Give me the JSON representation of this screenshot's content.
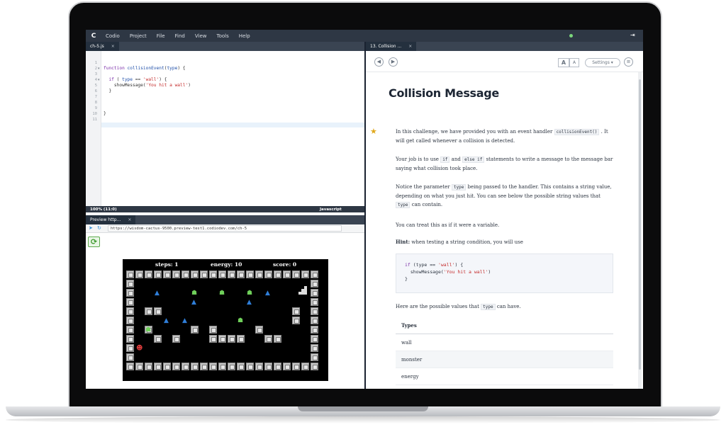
{
  "menu": {
    "items": [
      "Codio",
      "Project",
      "File",
      "Find",
      "View",
      "Tools",
      "Help"
    ]
  },
  "editor": {
    "tab_label": "ch-5.js",
    "tab_close": "×",
    "line_numbers": [
      "1",
      "2",
      "3",
      "4",
      "5",
      "6",
      "7",
      "8",
      "9",
      "10",
      "11"
    ],
    "status_position": "100%   (11:0)",
    "status_language": "Javascript"
  },
  "preview": {
    "tab_label": "Preview http...",
    "tab_close": "×",
    "url": "https://wisdom-cactus-9500.preview-test1.codiodev.com/ch-5",
    "reload_symbol": "⟳"
  },
  "game": {
    "steps": "steps: 1",
    "energy": "energy: 10",
    "score": "score: 0"
  },
  "guide": {
    "tab_label": "13. Collision ...",
    "tab_close": "×",
    "title": "Collision Message",
    "settings_label": "Settings",
    "p1_a": "In this challenge, we have provided you with an event handler",
    "p1_code": "collisionEvent()",
    "p1_b": ". It will get called whenever a collision is detected.",
    "p2_a": "Your job is to use",
    "p2_code1": "if",
    "p2_and": "and",
    "p2_code2": "else if",
    "p2_b": "statements to write a message to the message bar saying what collision took place.",
    "p3_a": "Notice the parameter",
    "p3_code": "type",
    "p3_b": "being passed to the handler. This contains a string value, depending on what you just hit. You can see below the possible string values that",
    "p3_code2": "type",
    "p3_c": "can contain.",
    "p4": "You can treat this as if it were a variable.",
    "hint_label": "Hint:",
    "hint_text": "when testing a string condition, you will use",
    "p5_a": "Here are the possible values that",
    "p5_code": "type",
    "p5_b": "can have.",
    "table_header": "Types",
    "types": [
      "wall",
      "monster",
      "energy"
    ]
  }
}
